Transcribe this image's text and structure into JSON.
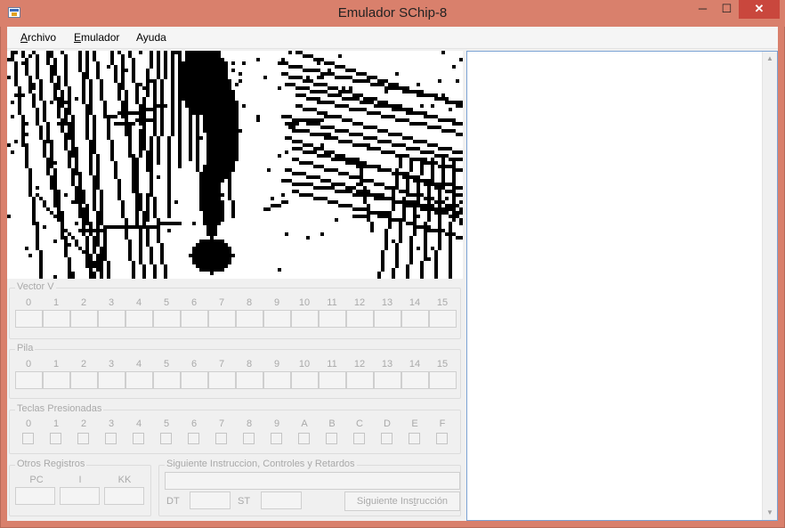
{
  "window": {
    "title": "Emulador SChip-8",
    "controls": {
      "minimize": "─",
      "maximize": "☐",
      "close": "✕"
    }
  },
  "menu": {
    "items": [
      {
        "accel": "A",
        "rest": "rchivo"
      },
      {
        "accel": "E",
        "rest": "mulador"
      },
      {
        "accel": "",
        "rest": "Ayuda"
      }
    ]
  },
  "vector_v": {
    "title": "Vector V",
    "labels": [
      "0",
      "1",
      "2",
      "3",
      "4",
      "5",
      "6",
      "7",
      "8",
      "9",
      "10",
      "11",
      "12",
      "13",
      "14",
      "15"
    ],
    "values": [
      "",
      "",
      "",
      "",
      "",
      "",
      "",
      "",
      "",
      "",
      "",
      "",
      "",
      "",
      "",
      ""
    ]
  },
  "pila": {
    "title": "Pila",
    "labels": [
      "0",
      "1",
      "2",
      "3",
      "4",
      "5",
      "6",
      "7",
      "8",
      "9",
      "10",
      "11",
      "12",
      "13",
      "14",
      "15"
    ],
    "values": [
      "",
      "",
      "",
      "",
      "",
      "",
      "",
      "",
      "",
      "",
      "",
      "",
      "",
      "",
      "",
      ""
    ]
  },
  "teclas": {
    "title": "Teclas Presionadas",
    "labels": [
      "0",
      "1",
      "2",
      "3",
      "4",
      "5",
      "6",
      "7",
      "8",
      "9",
      "A",
      "B",
      "C",
      "D",
      "E",
      "F"
    ],
    "checked": [
      false,
      false,
      false,
      false,
      false,
      false,
      false,
      false,
      false,
      false,
      false,
      false,
      false,
      false,
      false,
      false
    ]
  },
  "otros": {
    "title": "Otros Registros",
    "pc_label": "PC",
    "i_label": "I",
    "kk_label": "KK",
    "pc_value": "",
    "i_value": "",
    "kk_value": ""
  },
  "siguiente": {
    "title": "Siguiente Instruccion, Controles y Retardos",
    "instruction_value": "",
    "dt_label": "DT",
    "st_label": "ST",
    "dt_value": "",
    "st_value": "",
    "button_label": "Siguiente Instrucción",
    "button_accel_index": 13
  },
  "scroll": {
    "up_icon": "▲",
    "down_icon": "▼"
  },
  "colors": {
    "pixel_on": "#000000",
    "pixel_off": "#ffffff",
    "title_bar": "#d9806c",
    "close_button": "#c9473d"
  }
}
